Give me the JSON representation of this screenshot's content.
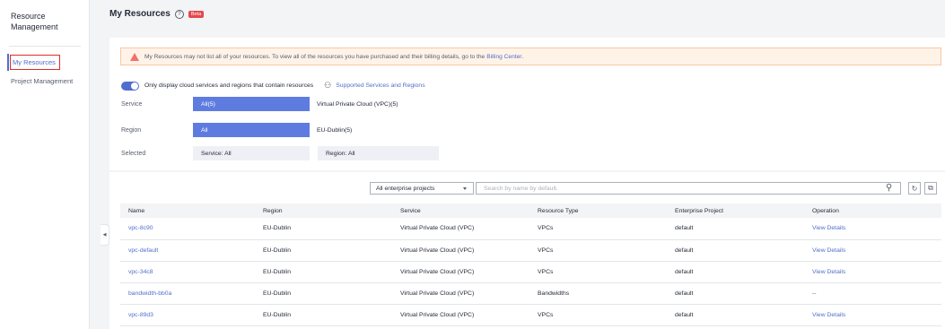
{
  "sidebar": {
    "title": "Resource Management",
    "items": [
      {
        "label": "My Resources"
      },
      {
        "label": "Project Management"
      }
    ]
  },
  "header": {
    "title": "My Resources",
    "help_icon": "?",
    "badge": "Beta"
  },
  "notice": {
    "text": "My Resources may not list all of your resources. To view all of the resources you have purchased and their billing details, go to the",
    "link": "Billing Center",
    "end": "."
  },
  "toggle": {
    "label": "Only display cloud services and regions that contain resources",
    "on": true
  },
  "supported_link": "Supported Services and Regions",
  "filters": {
    "service_label": "Service",
    "service_selected": "All(5)",
    "service_option": "Virtual Private Cloud (VPC)(5)",
    "region_label": "Region",
    "region_selected": "All",
    "region_option": "EU-Dublin(5)",
    "selected_label": "Selected",
    "selected_service": "Service: All",
    "selected_region": "Region: All"
  },
  "toolbar": {
    "project_select": "All enterprise projects",
    "search_placeholder": "Search by name by default."
  },
  "table": {
    "columns": [
      "Name",
      "Region",
      "Service",
      "Resource Type",
      "Enterprise Project",
      "Operation"
    ],
    "rows": [
      {
        "name": "vpc-8c90",
        "region": "EU-Dublin",
        "service": "Virtual Private Cloud (VPC)",
        "type": "VPCs",
        "project": "default",
        "operation": "View Details"
      },
      {
        "name": "vpc-default",
        "region": "EU-Dublin",
        "service": "Virtual Private Cloud (VPC)",
        "type": "VPCs",
        "project": "default",
        "operation": "View Details"
      },
      {
        "name": "vpc-34c8",
        "region": "EU-Dublin",
        "service": "Virtual Private Cloud (VPC)",
        "type": "VPCs",
        "project": "default",
        "operation": "View Details"
      },
      {
        "name": "bandwidth-bb0a",
        "region": "EU-Dublin",
        "service": "Virtual Private Cloud (VPC)",
        "type": "Bandwidths",
        "project": "default",
        "operation": "--"
      },
      {
        "name": "vpc-89d3",
        "region": "EU-Dublin",
        "service": "Virtual Private Cloud (VPC)",
        "type": "VPCs",
        "project": "default",
        "operation": "View Details"
      }
    ]
  },
  "colors": {
    "accent": "#526ecc",
    "chip": "#5e7ce0",
    "badge": "#e5484d",
    "warning": "#f66f6a"
  }
}
